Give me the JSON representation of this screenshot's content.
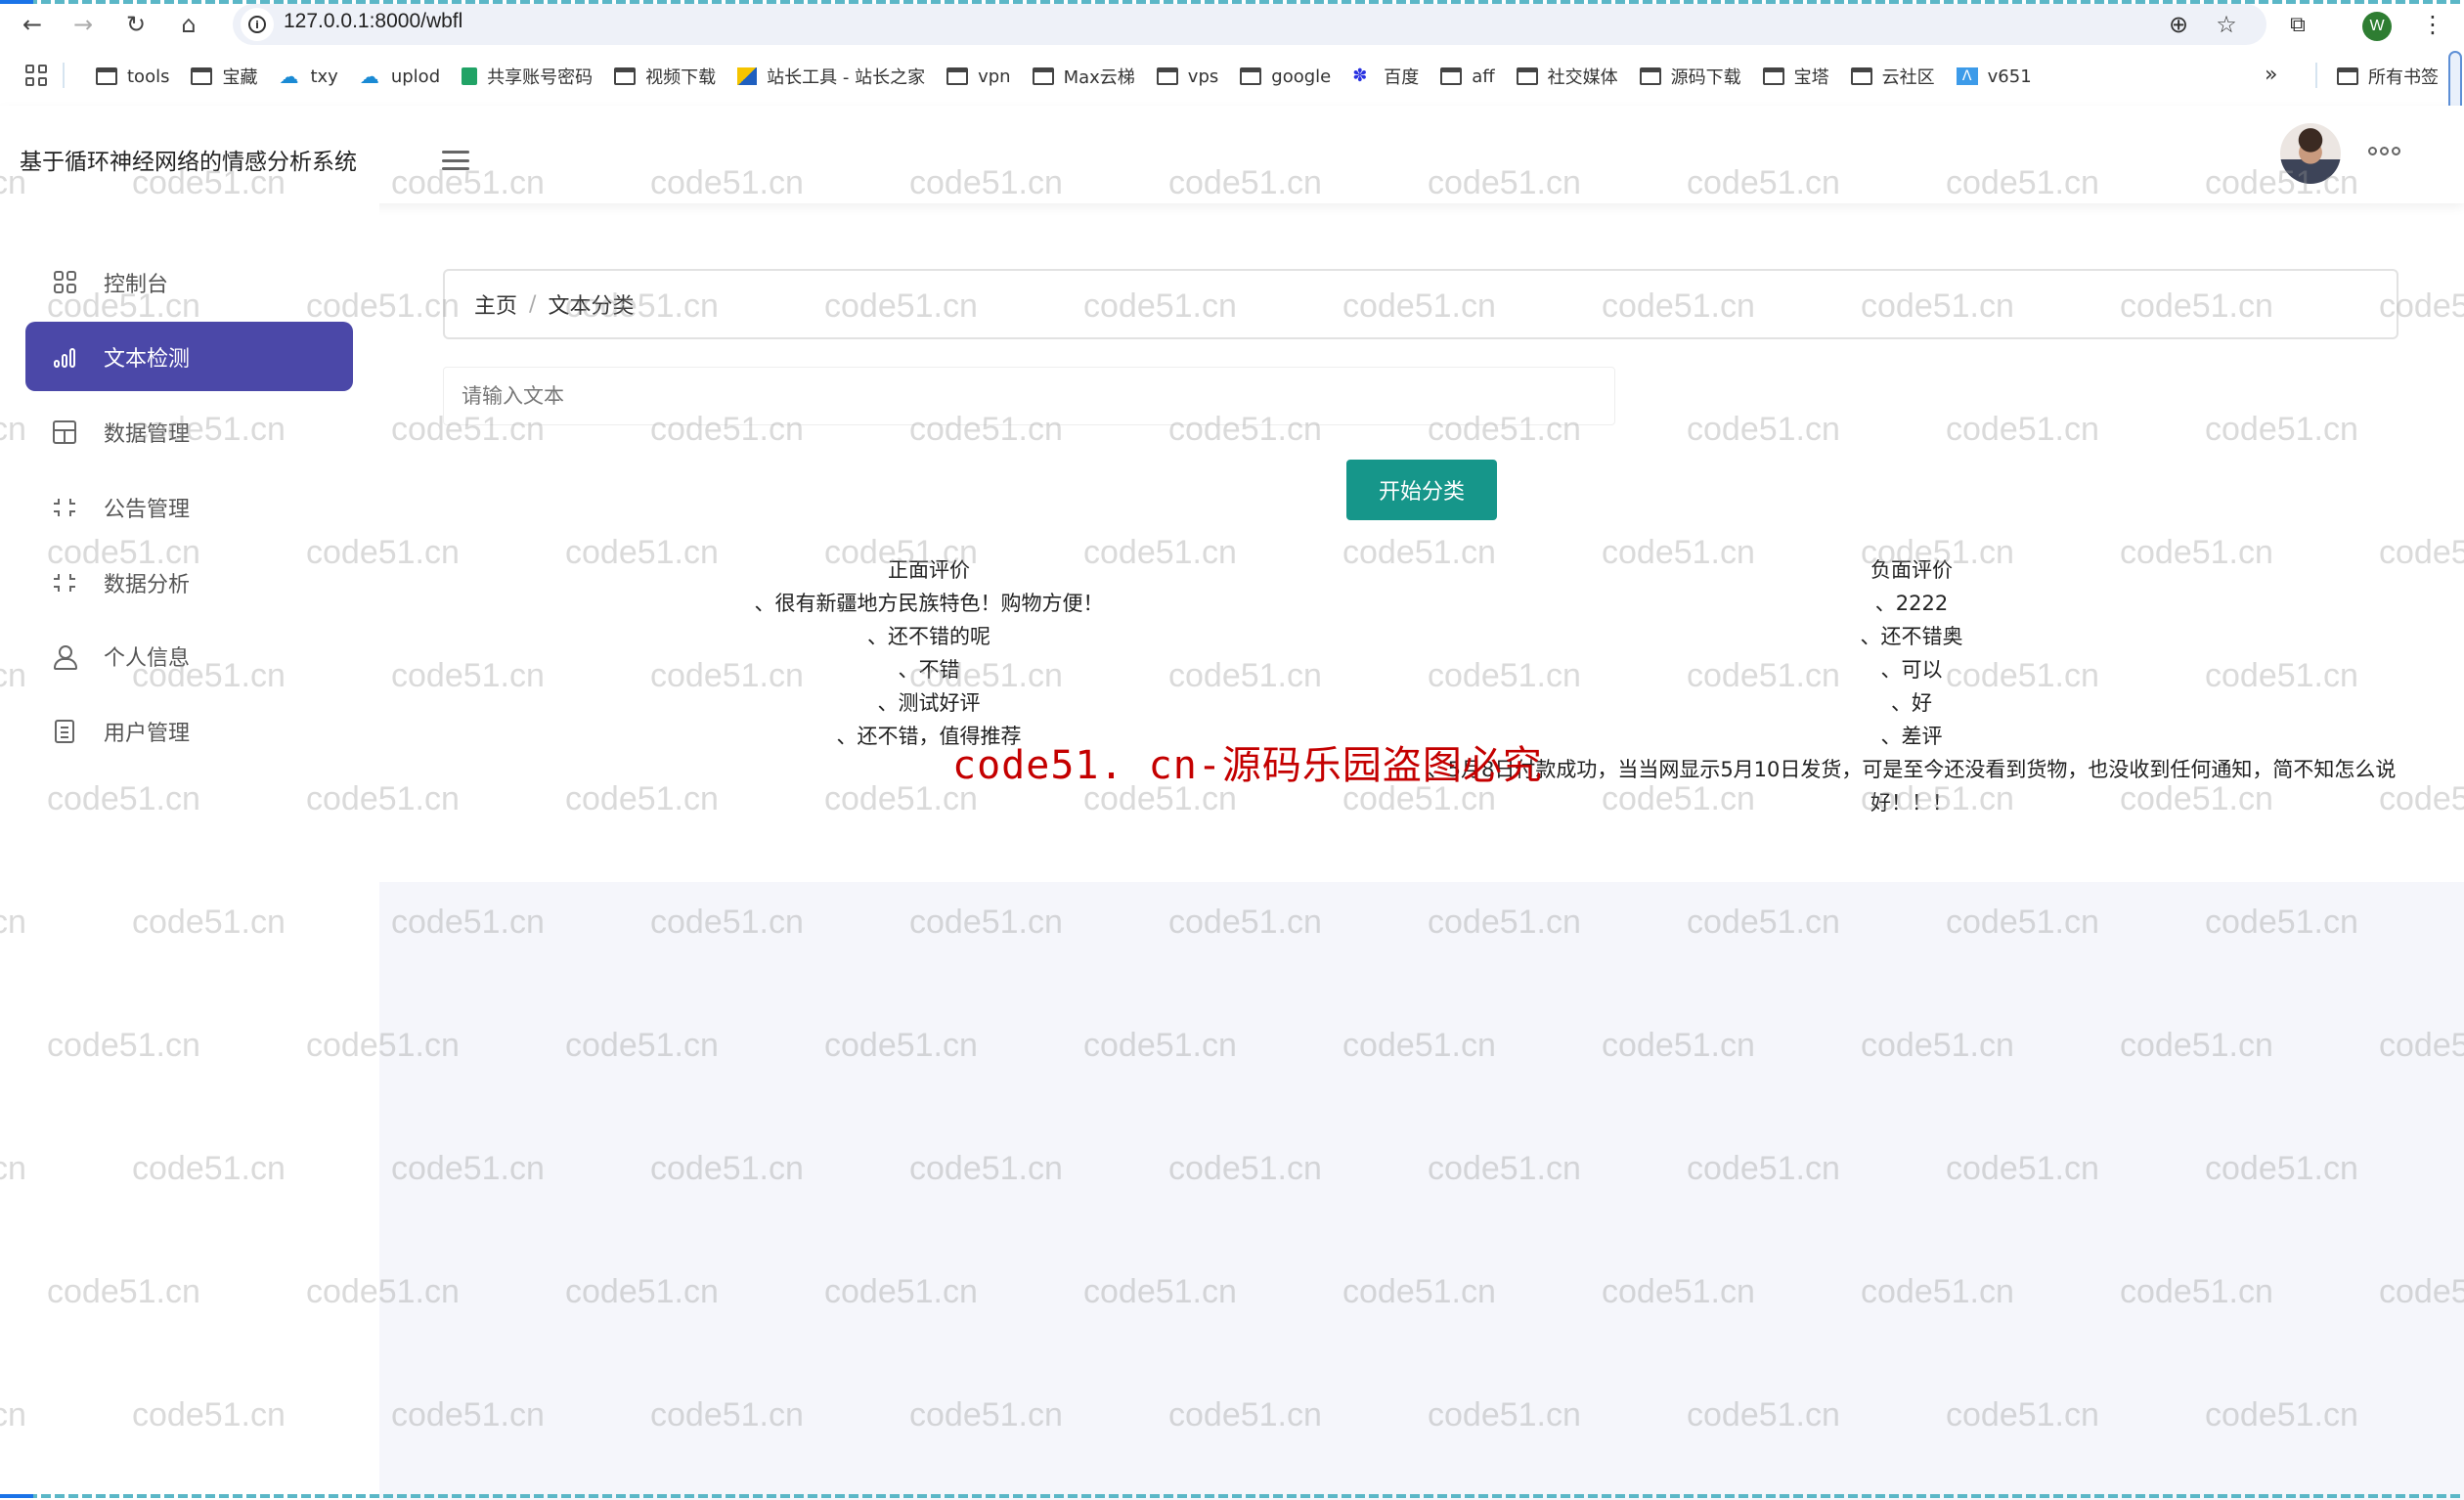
{
  "browser": {
    "url": "127.0.0.1:8000/wbfl",
    "profile_initial": "W",
    "bookmarks": [
      {
        "label": "tools",
        "icon": "folder"
      },
      {
        "label": "宝藏",
        "icon": "folder"
      },
      {
        "label": "txy",
        "icon": "cloud"
      },
      {
        "label": "uplod",
        "icon": "cloud"
      },
      {
        "label": "共享账号密码",
        "icon": "sheet"
      },
      {
        "label": "视频下载",
        "icon": "folder"
      },
      {
        "label": "站长工具 - 站长之家",
        "icon": "zz"
      },
      {
        "label": "vpn",
        "icon": "folder"
      },
      {
        "label": "Max云梯",
        "icon": "folder"
      },
      {
        "label": "vps",
        "icon": "folder"
      },
      {
        "label": "google",
        "icon": "folder"
      },
      {
        "label": "百度",
        "icon": "paw"
      },
      {
        "label": "aff",
        "icon": "folder"
      },
      {
        "label": "社交媒体",
        "icon": "folder"
      },
      {
        "label": "源码下载",
        "icon": "folder"
      },
      {
        "label": "宝塔",
        "icon": "folder"
      },
      {
        "label": "云社区",
        "icon": "folder"
      },
      {
        "label": "v651",
        "icon": "v"
      }
    ],
    "more_bookmarks": "»",
    "all_bookmarks": "所有书签"
  },
  "header": {
    "title": "基于循环神经网络的情感分析系统"
  },
  "sidebar": {
    "items": [
      {
        "label": "控制台",
        "icon": "grid-icon",
        "active": false
      },
      {
        "label": "文本检测",
        "icon": "bar-chart-icon",
        "active": true
      },
      {
        "label": "数据管理",
        "icon": "table-icon",
        "active": false
      },
      {
        "label": "公告管理",
        "icon": "shrink-icon",
        "active": false
      },
      {
        "label": "数据分析",
        "icon": "shrink-icon",
        "active": false
      },
      {
        "label": "个人信息",
        "icon": "user-icon",
        "active": false
      },
      {
        "label": "用户管理",
        "icon": "document-icon",
        "active": false
      }
    ]
  },
  "breadcrumb": {
    "home": "主页",
    "separator": "/",
    "current": "文本分类"
  },
  "form": {
    "input_value": "",
    "input_placeholder": "请输入文本",
    "submit_label": "开始分类"
  },
  "results": {
    "positive": {
      "title": "正面评价",
      "entries": [
        "、很有新疆地方民族特色！购物方便！",
        "、还不错的呢",
        "、不错",
        "、测试好评",
        "、还不错，值得推荐"
      ]
    },
    "negative": {
      "title": "负面评价",
      "entries": [
        "、2222",
        "、还不错奥",
        "、可以",
        "、好",
        "、差评",
        "、5月8日付款成功，当当网显示5月10日发货，可是至今还没看到货物，也没收到任何通知，简不知怎么说好！！！"
      ]
    }
  },
  "watermark": {
    "tile_text": "code51.cn",
    "banner_text": "code51. cn-源码乐园盗图必究"
  },
  "colors": {
    "sidebar_active": "#4b48a8",
    "primary_button": "#16968a",
    "watermark_banner": "#c40000"
  }
}
